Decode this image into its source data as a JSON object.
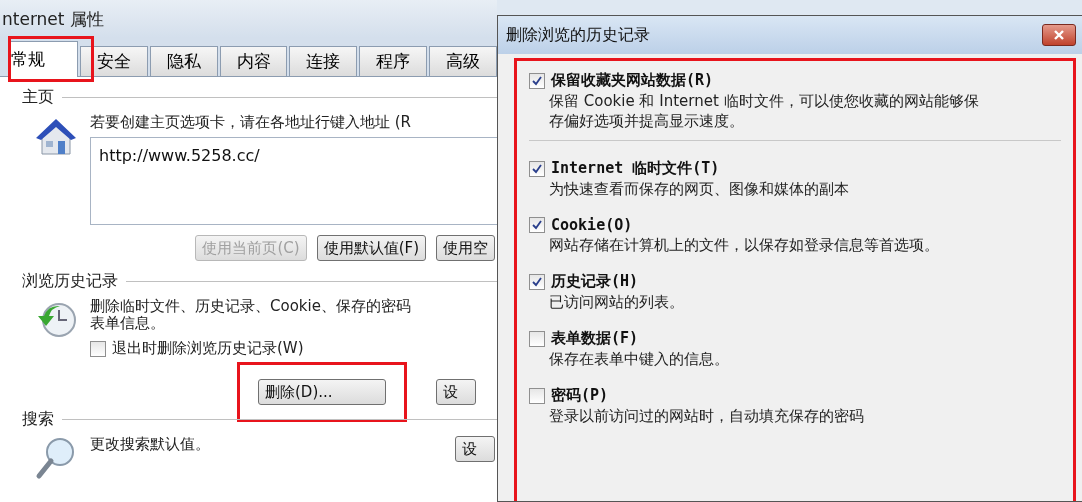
{
  "window": {
    "title": "nternet 属性"
  },
  "tabs": [
    {
      "label": "常规",
      "selected": true
    },
    {
      "label": "安全",
      "selected": false
    },
    {
      "label": "隐私",
      "selected": false
    },
    {
      "label": "内容",
      "selected": false
    },
    {
      "label": "连接",
      "selected": false
    },
    {
      "label": "程序",
      "selected": false
    },
    {
      "label": "高级",
      "selected": false
    }
  ],
  "home_page": {
    "heading": "主页",
    "hint": "若要创建主页选项卡，请在各地址行键入地址 (R",
    "url": "http://www.5258.cc/",
    "buttons": [
      {
        "label": "使用当前页(C)",
        "disabled": true
      },
      {
        "label": "使用默认值(F)",
        "disabled": false
      },
      {
        "label": "使用空",
        "disabled": false
      }
    ]
  },
  "history": {
    "heading": "浏览历史记录",
    "description_lines": [
      "删除临时文件、历史记录、Cookie、保存的密码",
      "表单信息。"
    ],
    "delete_on_exit": {
      "label": "退出时删除浏览历史记录(W)",
      "checked": false
    },
    "buttons": [
      {
        "label": "删除(D)...",
        "highlighted": true
      },
      {
        "label": "设",
        "highlighted": false
      }
    ]
  },
  "search": {
    "heading": "搜索",
    "description": "更改搜索默认值。",
    "button": "设"
  },
  "dialog": {
    "title": "删除浏览的历史记录",
    "options": [
      {
        "label": "保留收藏夹网站数据(R)",
        "description_lines": [
          "保留 Cookie 和 Internet 临时文件，可以使您收藏的网站能够保",
          "存偏好选项并提高显示速度。"
        ],
        "checked": true,
        "separator": true
      },
      {
        "label": "Internet 临时文件(T)",
        "description_lines": [
          "为快速查看而保存的网页、图像和媒体的副本"
        ],
        "checked": true,
        "separator": false
      },
      {
        "label": "Cookie(O)",
        "description_lines": [
          "网站存储在计算机上的文件，以保存如登录信息等首选项。"
        ],
        "checked": true,
        "separator": false
      },
      {
        "label": "历史记录(H)",
        "description_lines": [
          "已访问网站的列表。"
        ],
        "checked": true,
        "separator": false
      },
      {
        "label": "表单数据(F)",
        "description_lines": [
          "保存在表单中键入的信息。"
        ],
        "checked": false,
        "separator": false
      },
      {
        "label": "密码(P)",
        "description_lines": [
          "登录以前访问过的网站时，自动填充保存的密码"
        ],
        "checked": false,
        "separator": false
      }
    ]
  }
}
